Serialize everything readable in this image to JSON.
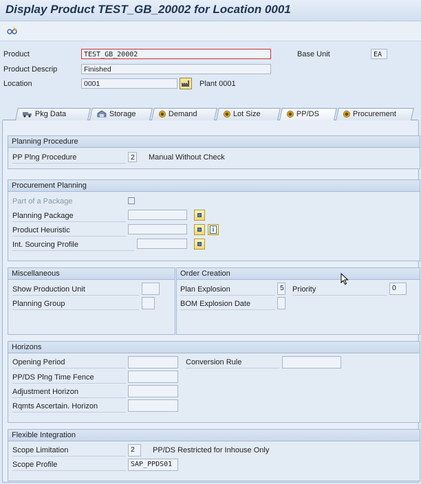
{
  "window": {
    "title": "Display Product TEST_GB_20002 for Location 0001"
  },
  "toolbar": {
    "icon": "glasses-change-icon"
  },
  "header": {
    "product_label": "Product",
    "product_value": "TEST_GB_20002",
    "base_unit_label": "Base Unit",
    "base_unit_value": "EA",
    "descrip_label": "Product Descrip",
    "descrip_value": "Finished",
    "location_label": "Location",
    "location_value": "0001",
    "location_text": "Plant 0001"
  },
  "tabs": [
    {
      "label": "Pkg Data",
      "icon": "truck-icon"
    },
    {
      "label": "Storage",
      "icon": "storage-icon"
    },
    {
      "label": "Demand",
      "icon": "status-dot-icon"
    },
    {
      "label": "Lot Size",
      "icon": "status-dot-icon"
    },
    {
      "label": "PP/DS",
      "icon": "status-dot-icon",
      "active": true
    },
    {
      "label": "Procurement",
      "icon": "status-dot-icon"
    }
  ],
  "planning_procedure": {
    "title": "Planning Procedure",
    "label": "PP Plng Procedure",
    "value": "2",
    "text": "Manual Without Check"
  },
  "procurement_planning": {
    "title": "Procurement Planning",
    "part_of_package": "Part of a Package",
    "planning_package": "Planning Package",
    "product_heuristic": "Product Heuristic",
    "sourcing_profile": "Int. Sourcing Profile"
  },
  "miscellaneous": {
    "title": "Miscellaneous",
    "show_production_unit": "Show Production Unit",
    "planning_group": "Planning Group"
  },
  "order_creation": {
    "title": "Order Creation",
    "plan_explosion_label": "Plan Explosion",
    "plan_explosion_value": "5",
    "priority_label": "Priority",
    "priority_value": "0",
    "bom_explosion_date": "BOM Explosion Date"
  },
  "horizons": {
    "title": "Horizons",
    "opening_period": "Opening Period",
    "conversion_rule": "Conversion Rule",
    "ppds_time_fence": "PP/DS Plng Time Fence",
    "adjustment_horizon": "Adjustment Horizon",
    "rqmts_horizon": "Rqmts Ascertain. Horizon"
  },
  "flexible_integration": {
    "title": "Flexible Integration",
    "scope_limitation_label": "Scope Limitation",
    "scope_limitation_value": "2",
    "scope_limitation_text": "PP/DS Restricted for Inhouse Only",
    "scope_profile_label": "Scope Profile",
    "scope_profile_value": "SAP_PPDS01"
  }
}
